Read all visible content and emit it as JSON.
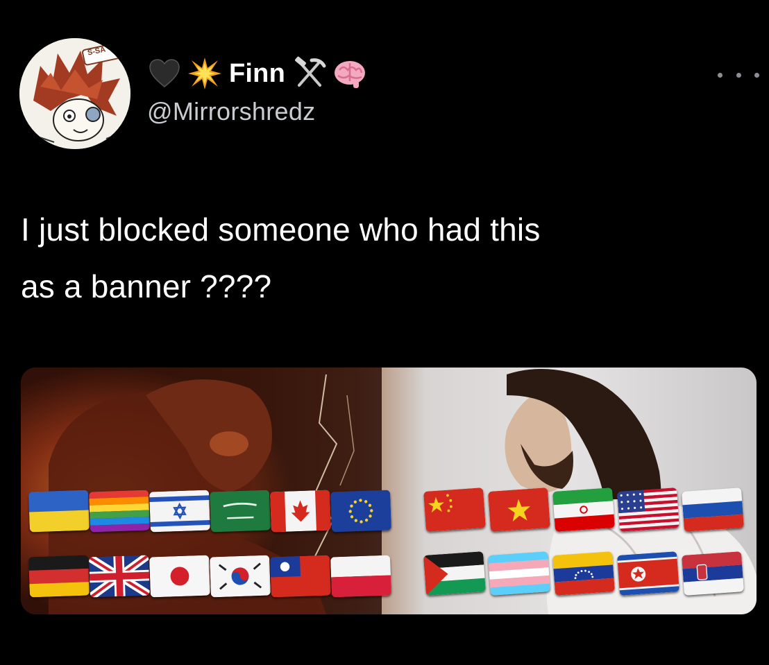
{
  "user": {
    "display_name": "Finn",
    "handle": "@Mirrorshredz",
    "avatar_sign_text": "S-SA",
    "name_emojis_before": [
      "black-heart-icon",
      "collision-icon"
    ],
    "name_emojis_after": [
      "hammer-and-pick-icon",
      "brain-icon"
    ]
  },
  "tweet": {
    "text_line1": "I just blocked someone who had this",
    "text_line2": "as a banner ????"
  },
  "media": {
    "left_flags": [
      [
        "ukraine-flag-icon",
        "rainbow-flag-icon",
        "israel-flag-icon",
        "saudi-arabia-flag-icon",
        "canada-flag-icon",
        "european-union-flag-icon"
      ],
      [
        "germany-flag-icon",
        "united-kingdom-flag-icon",
        "japan-flag-icon",
        "south-korea-flag-icon",
        "taiwan-flag-icon",
        "poland-flag-icon"
      ]
    ],
    "right_flags": [
      [
        "china-flag-icon",
        "vietnam-flag-icon",
        "iran-flag-icon",
        "united-states-flag-icon",
        "russia-flag-icon"
      ],
      [
        "palestine-flag-icon",
        "transgender-flag-icon",
        "venezuela-flag-icon",
        "north-korea-flag-icon",
        "serbia-flag-icon"
      ]
    ]
  },
  "colors": {
    "background": "#000000",
    "text_primary": "#ffffff",
    "text_secondary": "#c9ccd0",
    "more_dots": "#8b8f94"
  }
}
